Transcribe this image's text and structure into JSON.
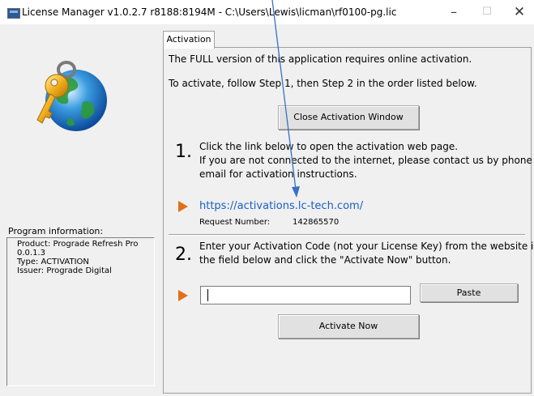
{
  "window": {
    "title": "License Manager v1.0.2.7 r8188:8194M - C:\\Users\\Lewis\\licman\\rf0100-pg.lic",
    "minimize_glyph": "–",
    "maximize_glyph": "☐",
    "close_glyph": "✕"
  },
  "left_panel": {
    "logo": "key-globe-icon",
    "program_info_label": "Program information:",
    "program_info_lines": [
      "Product: Prograde Refresh Pro",
      "0.0.1.3",
      "Type: ACTIVATION",
      "Issuer: Prograde Digital"
    ]
  },
  "tab": {
    "label": "Activation"
  },
  "activation": {
    "intro_line1": "The FULL version of this application requires online activation.",
    "intro_line2": "To activate, follow Step 1, then Step 2 in the order listed below.",
    "close_button": "Close Activation Window",
    "step1": {
      "number": "1.",
      "line1": "Click the link below to open the activation web page.",
      "line2": "If you are not connected to the internet, please contact us by phone or",
      "line3": "email for activation instructions.",
      "link": "https://activations.lc-tech.com/",
      "request_label": "Request Number:",
      "request_value": "142865570"
    },
    "step2": {
      "number": "2.",
      "line1": "Enter your Activation Code (not your License Key) from the website into",
      "line2": "the field below and click the \"Activate Now\" button.",
      "code_value": "",
      "paste_button": "Paste",
      "activate_button": "Activate Now"
    }
  },
  "colors": {
    "accent_arrow": "#e0701a",
    "link": "#1a5fc7",
    "annotation_line": "#3a6fc4"
  }
}
